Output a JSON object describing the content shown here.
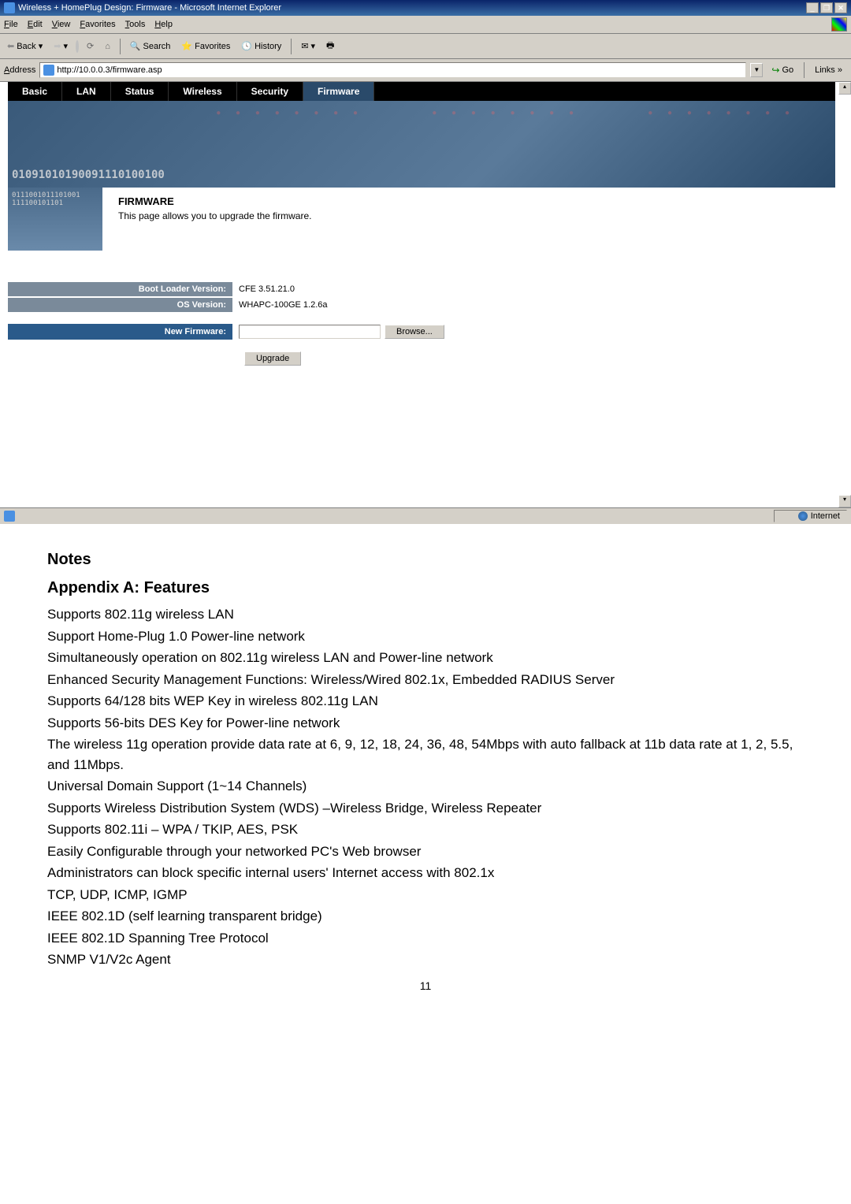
{
  "titleBar": "Wireless + HomePlug Design: Firmware - Microsoft Internet Explorer",
  "menu": {
    "file": "File",
    "edit": "Edit",
    "view": "View",
    "favorites": "Favorites",
    "tools": "Tools",
    "help": "Help"
  },
  "toolbar": {
    "back": "Back",
    "search": "Search",
    "favorites": "Favorites",
    "history": "History"
  },
  "addressBar": {
    "label": "Address",
    "url": "http://10.0.0.3/firmware.asp",
    "go": "Go",
    "links": "Links"
  },
  "tabs": {
    "basic": "Basic",
    "lan": "LAN",
    "status": "Status",
    "wireless": "Wireless",
    "security": "Security",
    "firmware": "Firmware"
  },
  "banner": {
    "line1": "01091010190091110100100",
    "line2": "0111001011101001"
  },
  "leftPanel": "111100101101",
  "firmware": {
    "title": "FIRMWARE",
    "desc": "This page allows you to upgrade the firmware."
  },
  "info": {
    "bootLabel": "Boot Loader Version:",
    "bootValue": "CFE 3.51.21.0",
    "osLabel": "OS Version:",
    "osValue": "WHAPC-100GE 1.2.6a",
    "newFwLabel": "New Firmware:",
    "browseBtn": "Browse...",
    "upgradeBtn": "Upgrade"
  },
  "statusBar": {
    "zone": "Internet"
  },
  "doc": {
    "notes": "Notes",
    "appendix": "Appendix A: Features",
    "lines": [
      "Supports 802.11g wireless LAN",
      "Support Home-Plug 1.0 Power-line network",
      "Simultaneously operation on 802.11g wireless LAN and Power-line network",
      "Enhanced Security Management Functions: Wireless/Wired 802.1x, Embedded RADIUS Server",
      "Supports 64/128 bits WEP Key in wireless 802.11g LAN",
      "Supports 56-bits DES Key for Power-line network",
      "The wireless 11g operation provide data rate at 6, 9, 12, 18, 24, 36, 48, 54Mbps with auto fallback at 11b data rate at 1, 2, 5.5, and 11Mbps.",
      "Universal Domain Support (1~14 Channels)",
      "Supports Wireless Distribution System (WDS) –Wireless Bridge, Wireless Repeater",
      "Supports 802.11i – WPA / TKIP, AES, PSK",
      "Easily Configurable through your networked PC's Web browser",
      "Administrators can block specific internal users' Internet access with 802.1x",
      "TCP, UDP, ICMP, IGMP",
      "IEEE 802.1D (self learning transparent bridge)",
      "IEEE 802.1D Spanning Tree Protocol",
      "SNMP V1/V2c Agent"
    ],
    "pageNum": "11"
  }
}
